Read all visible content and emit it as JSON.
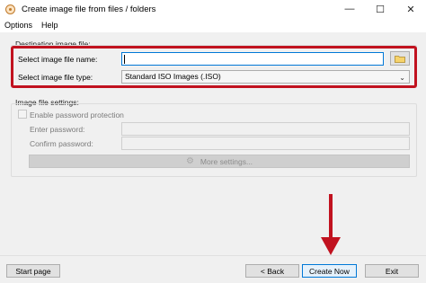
{
  "window": {
    "title": "Create image file from files / folders",
    "controls": {
      "minimize": "—",
      "maximize": "☐",
      "close": "✕"
    }
  },
  "menu": {
    "items": [
      "Options",
      "Help"
    ]
  },
  "destination": {
    "group_label": "Destination image file:",
    "name_label": "Select image file name:",
    "name_value": "",
    "type_label": "Select image file type:",
    "type_value": "Standard ISO Images (.ISO)",
    "highlight_color": "#c1121f"
  },
  "settings": {
    "group_label": "Image file settings:",
    "password_protection_label": "Enable password protection",
    "enter_password_label": "Enter password:",
    "confirm_password_label": "Confirm password:",
    "more_settings_label": "More settings..."
  },
  "footer": {
    "start_label": "Start page",
    "back_label": "< Back",
    "create_label": "Create Now",
    "exit_label": "Exit"
  },
  "icons": {
    "app": "app-disc-icon",
    "folder": "folder-icon",
    "dropdown": "chevron-down-icon",
    "gear": "gear-icon",
    "annotation": "red-arrow-icon"
  }
}
